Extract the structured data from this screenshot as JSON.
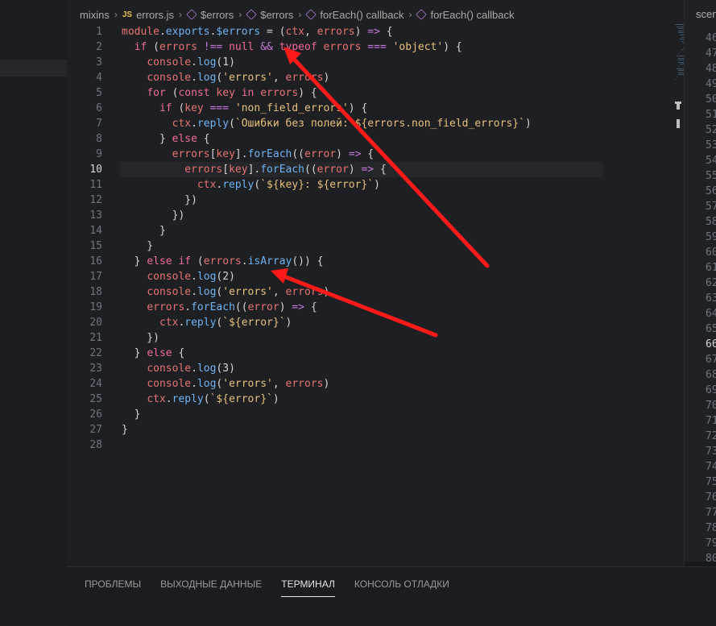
{
  "breadcrumb": [
    {
      "label": "mixins",
      "icon": null
    },
    {
      "label": "errors.js",
      "icon": "js-file-icon"
    },
    {
      "label": "$errors",
      "icon": "symbol-cube-icon"
    },
    {
      "label": "$errors",
      "icon": "symbol-cube-icon"
    },
    {
      "label": "forEach() callback",
      "icon": "symbol-cube-icon"
    },
    {
      "label": "forEach() callback",
      "icon": "symbol-cube-icon"
    }
  ],
  "editor": {
    "active_line": 10,
    "line_numbers": [
      "1",
      "2",
      "3",
      "4",
      "5",
      "6",
      "7",
      "8",
      "9",
      "10",
      "11",
      "12",
      "13",
      "14",
      "15",
      "16",
      "17",
      "18",
      "19",
      "20",
      "21",
      "22",
      "23",
      "24",
      "25",
      "26",
      "27",
      "28"
    ],
    "code_lines": [
      "module.exports.$errors = (ctx, errors) => {",
      "  if (errors !== null && typeof errors === 'object') {",
      "    console.log(1)",
      "    console.log('errors', errors)",
      "    for (const key in errors) {",
      "      if (key === 'non_field_errors') {",
      "        ctx.reply(`Ошибки без полей: ${errors.non_field_errors}`)",
      "      } else {",
      "        errors[key].forEach((error) => {",
      "          errors[key].forEach((error) => {",
      "            ctx.reply(`${key}: ${error}`)",
      "          })",
      "        })",
      "      }",
      "    }",
      "  } else if (errors.isArray()) {",
      "    console.log(2)",
      "    console.log('errors', errors)",
      "    errors.forEach((error) => {",
      "      ctx.reply(`${error}`)",
      "    })",
      "  } else {",
      "    console.log(3)",
      "    console.log('errors', errors)",
      "    ctx.reply(`${error}`)",
      "  }",
      "}",
      ""
    ]
  },
  "right_panel": {
    "tab_label": "scen",
    "line_numbers": [
      "46",
      "47",
      "48",
      "49",
      "50",
      "51",
      "52",
      "53",
      "54",
      "55",
      "56",
      "57",
      "58",
      "59",
      "60",
      "61",
      "62",
      "63",
      "64",
      "65",
      "66",
      "67",
      "68",
      "69",
      "70",
      "71",
      "72",
      "73",
      "74",
      "75",
      "76",
      "77",
      "78",
      "79",
      "80"
    ],
    "active_line": "66"
  },
  "panel": {
    "tabs": [
      "ПРОБЛЕМЫ",
      "ВЫХОДНЫЕ ДАННЫЕ",
      "ТЕРМИНАЛ",
      "КОНСОЛЬ ОТЛАДКИ"
    ],
    "active_tab": "ТЕРМИНАЛ"
  },
  "colors": {
    "background": "#1e1f22",
    "keyword": "#f06a9b",
    "function": "#6fb3f2",
    "variable": "#e57373",
    "string": "#e6c07b",
    "annotation_arrow": "#ff1a1a"
  }
}
